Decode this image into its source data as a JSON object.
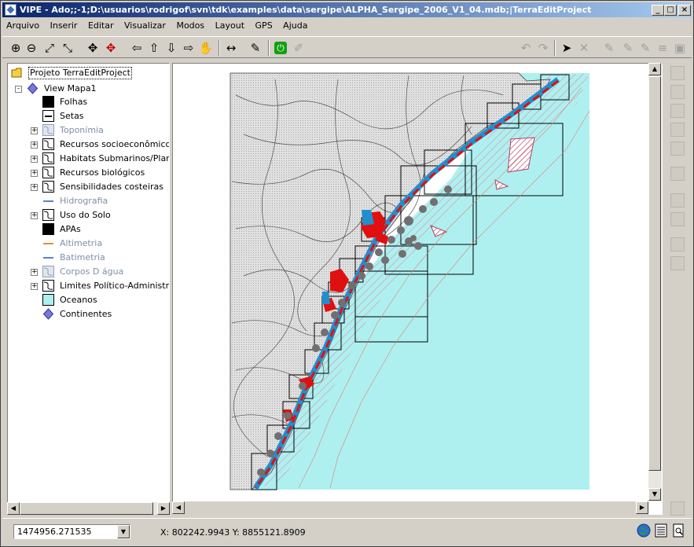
{
  "title": "VIPE - Ado;;-1;D:\\usuarios\\rodrigof\\svn\\tdk\\examples\\data\\sergipe\\ALPHA_Sergipe_2006_V1_04.mdb;|TerraEditProject",
  "window_buttons": {
    "minimize": "_",
    "maximize": "□",
    "close": "×"
  },
  "menu": [
    "Arquivo",
    "Inserir",
    "Editar",
    "Visualizar",
    "Modos",
    "Layout",
    "GPS",
    "Ajuda"
  ],
  "toolbar": {
    "zoom_in": "⊕",
    "zoom_out": "⊖",
    "zoom_extent": "⤢",
    "zoom_area": "⤡",
    "pan_move": "✥",
    "pan_move_red": "✥",
    "arrow_left": "⇦",
    "arrow_up": "⇧",
    "arrow_down": "⇩",
    "arrow_right": "⇨",
    "pan_hand": "✋",
    "measure": "↔",
    "edit_table": "✎",
    "gps": "⏻",
    "edit_disabled": "✐",
    "undo": "↶",
    "redo": "↷",
    "select": "➤",
    "delete": "✕",
    "pencil1": "✎",
    "pencil2": "✎",
    "pencil3": "✎",
    "ruler": "≡",
    "image": "▣"
  },
  "tree": {
    "project": "Projeto TerraEditProject",
    "view": "View Mapa1",
    "layers": [
      {
        "label": "Folhas",
        "expandable": false,
        "enabled": true
      },
      {
        "label": "Setas",
        "expandable": false,
        "enabled": true
      },
      {
        "label": "Toponímia",
        "expandable": true,
        "enabled": false
      },
      {
        "label": "Recursos socioeconômicos",
        "expandable": true,
        "enabled": true
      },
      {
        "label": "Habitats Submarinos/Plantas",
        "expandable": true,
        "enabled": true
      },
      {
        "label": "Recursos biológicos",
        "expandable": true,
        "enabled": true
      },
      {
        "label": "Sensibilidades costeiras",
        "expandable": true,
        "enabled": true
      },
      {
        "label": "Hidrografia",
        "expandable": false,
        "enabled": false
      },
      {
        "label": "Uso do Solo",
        "expandable": true,
        "enabled": true
      },
      {
        "label": "APAs",
        "expandable": false,
        "enabled": true
      },
      {
        "label": "Altimetria",
        "expandable": false,
        "enabled": false
      },
      {
        "label": "Batimetria",
        "expandable": false,
        "enabled": false
      },
      {
        "label": "Corpos D água",
        "expandable": true,
        "enabled": false
      },
      {
        "label": "Limites Político-Administrativos",
        "expandable": true,
        "enabled": true
      },
      {
        "label": "Oceanos",
        "expandable": false,
        "enabled": true
      },
      {
        "label": "Continentes",
        "expandable": false,
        "enabled": true
      }
    ]
  },
  "colors": {
    "ocean": "#aef0f0",
    "land": "#d8d8d8",
    "red_polygon": "#e01010",
    "blue_polygon": "#1f8fd0",
    "hatch": "#b04060",
    "title_start": "#0a246a",
    "title_end": "#a6caf0"
  },
  "status": {
    "scale": "1474956.271535",
    "coords": "X: 802242.9943  Y: 8855121.8909"
  },
  "status_icons": [
    "globe-icon",
    "table-icon",
    "print-preview-icon"
  ]
}
